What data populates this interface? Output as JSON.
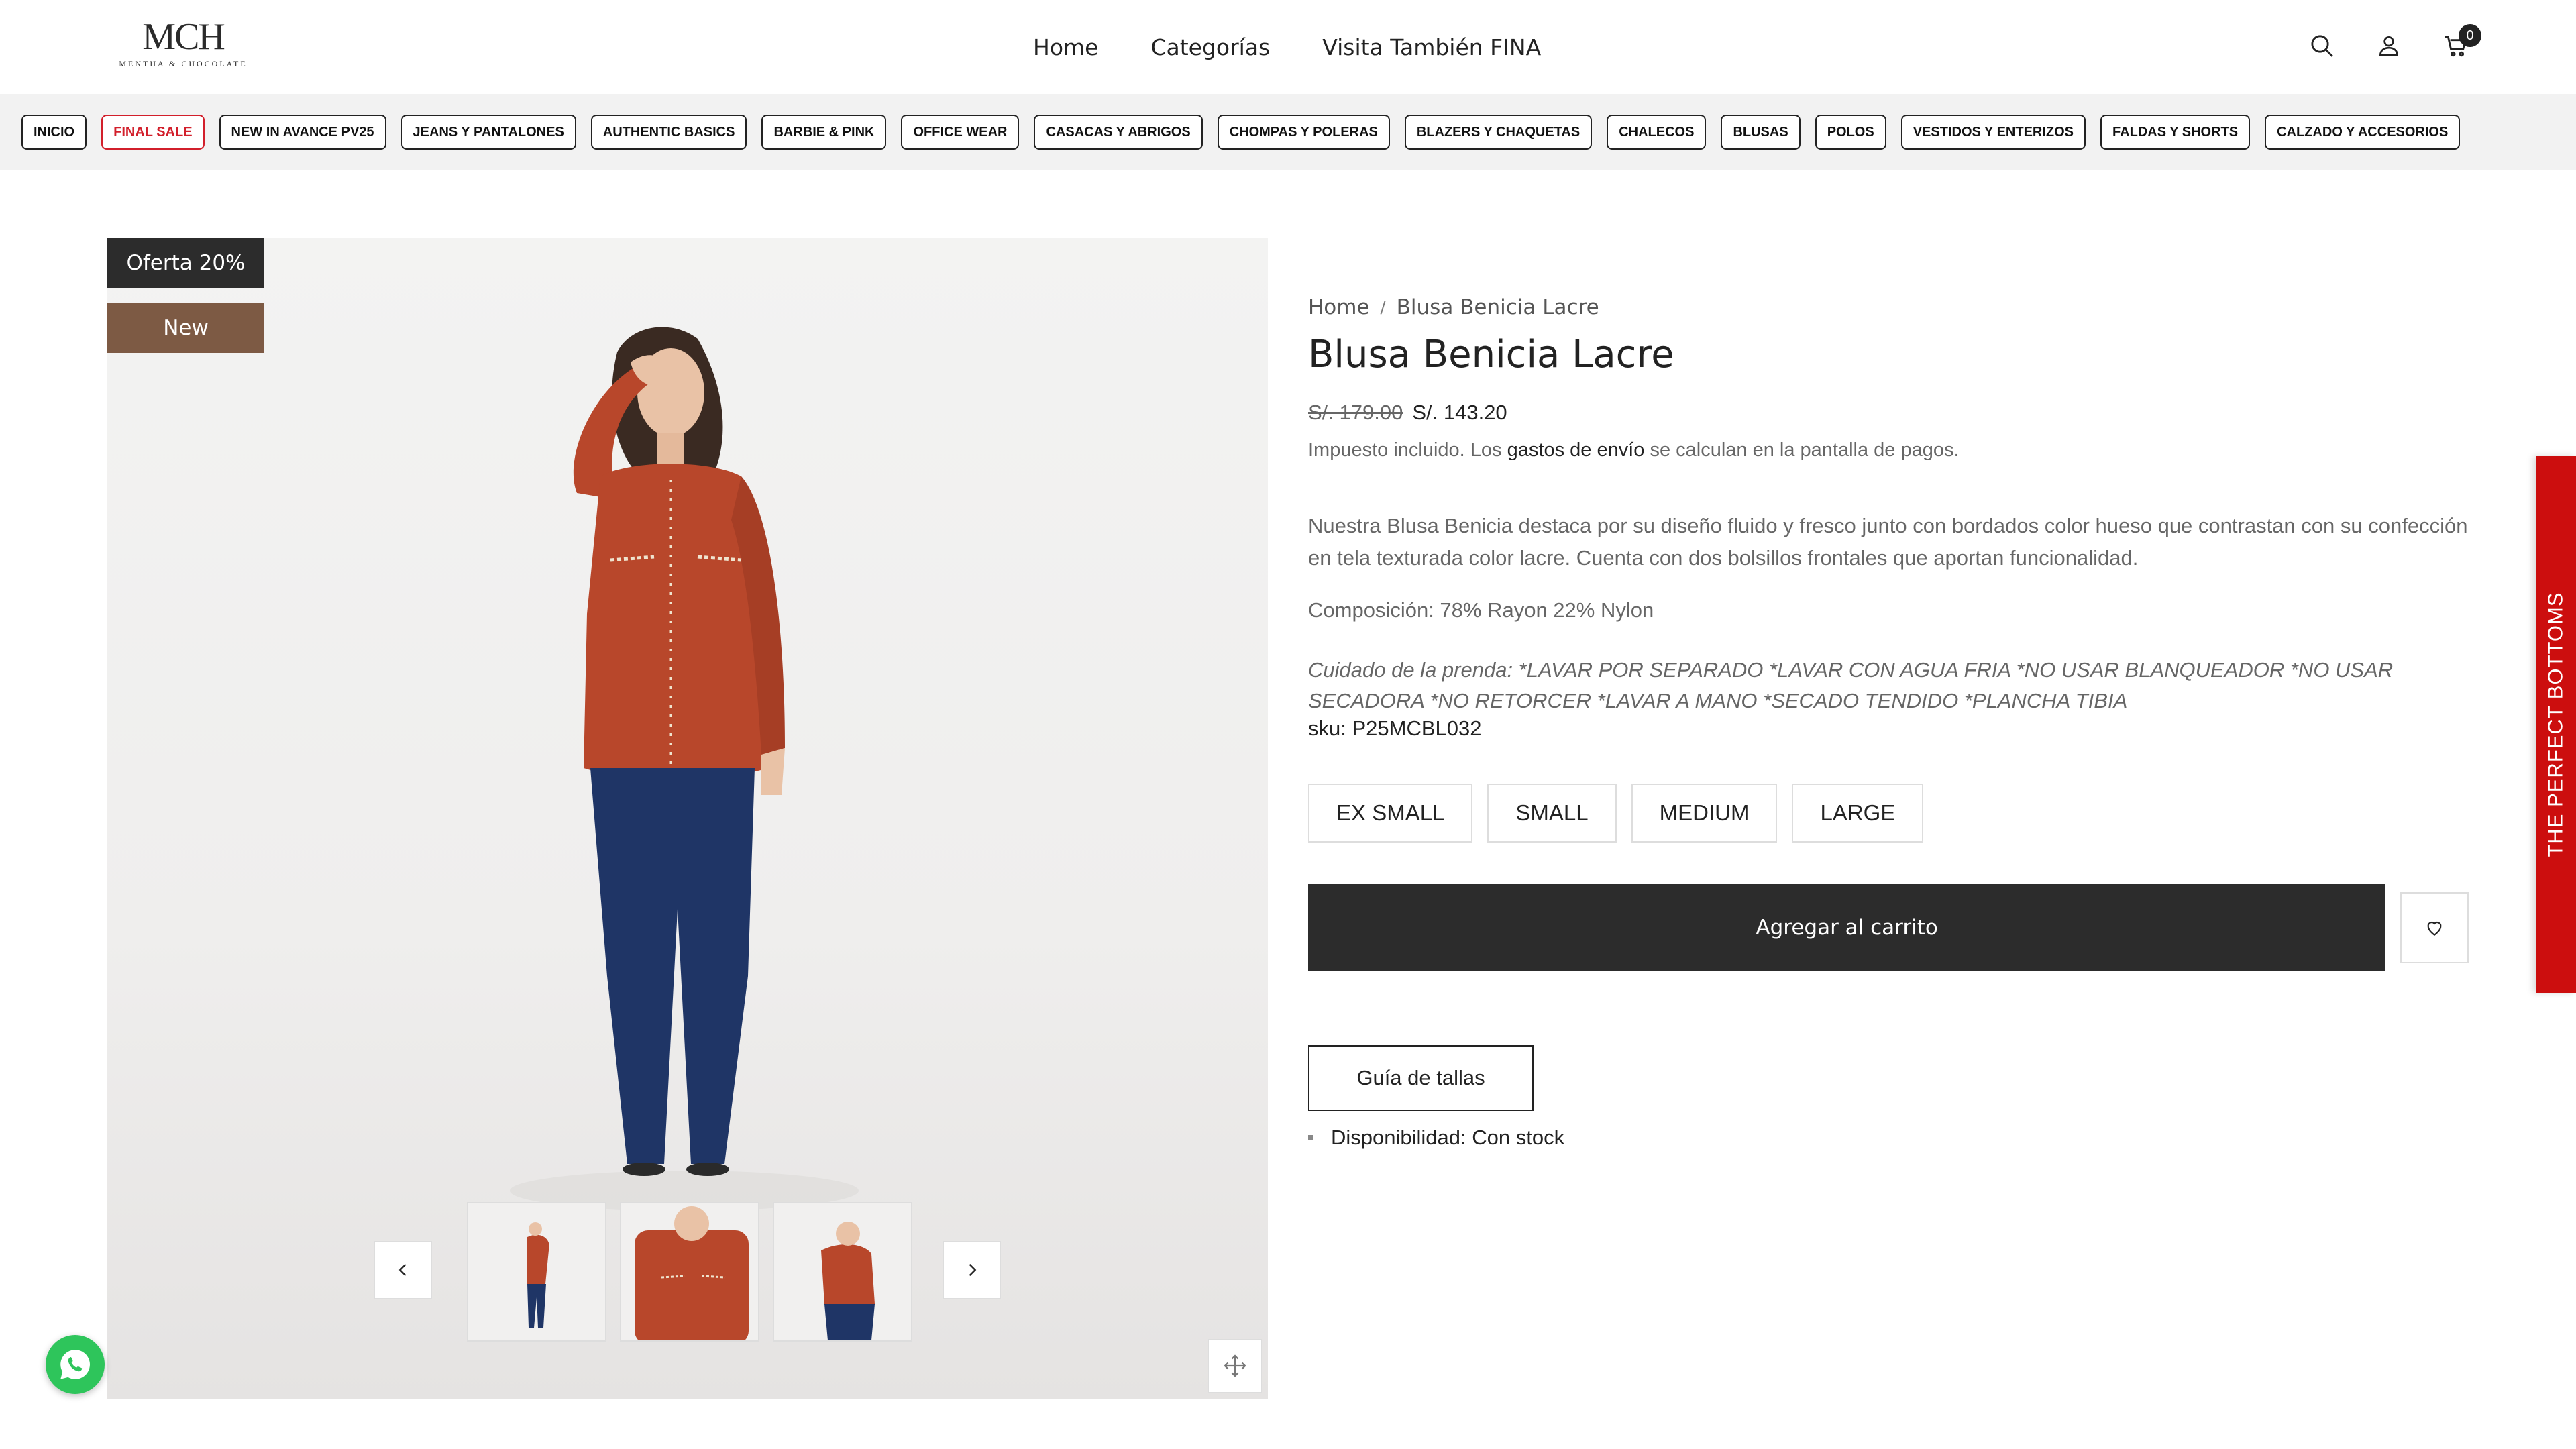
{
  "brand": {
    "logo_mark": "MCH",
    "logo_sub": "MENTHA & CHOCOLATE"
  },
  "nav": {
    "home": "Home",
    "categories": "Categorías",
    "visit": "Visita También FINA"
  },
  "cart": {
    "count": "0"
  },
  "categories": [
    "INICIO",
    "FINAL SALE",
    "NEW IN AVANCE PV25",
    "JEANS Y PANTALONES",
    "AUTHENTIC BASICS",
    "BARBIE & PINK",
    "OFFICE WEAR",
    "CASACAS Y ABRIGOS",
    "CHOMPAS Y POLERAS",
    "BLAZERS Y CHAQUETAS",
    "CHALECOS",
    "BLUSAS",
    "POLOS",
    "VESTIDOS Y ENTERIZOS",
    "FALDAS Y SHORTS",
    "CALZADO Y ACCESORIOS"
  ],
  "badges": {
    "sale": "Oferta 20%",
    "new": "New"
  },
  "product": {
    "breadcrumb_home": "Home",
    "breadcrumb_current": "Blusa Benicia Lacre",
    "title": "Blusa Benicia Lacre",
    "price_old": "S/. 179.00",
    "price_new": "S/. 143.20",
    "tax_pre": "Impuesto incluido. Los ",
    "tax_link": "gastos de envío",
    "tax_post": " se calculan en la pantalla de pagos.",
    "description": "Nuestra Blusa Benicia destaca por su diseño fluido y fresco junto con bordados color hueso que contrastan con su confección en tela texturada color lacre. Cuenta con dos bolsillos frontales que aportan funcionalidad.",
    "composition": "Composición: 78% Rayon 22% Nylon",
    "care": "Cuidado de la prenda: *LAVAR POR SEPARADO *LAVAR CON AGUA FRIA *NO USAR BLANQUEADOR *NO USAR SECADORA *NO RETORCER *LAVAR A MANO *SECADO TENDIDO *PLANCHA TIBIA",
    "sku": "sku: P25MCBL032",
    "sizes": [
      "EX SMALL",
      "SMALL",
      "MEDIUM",
      "LARGE"
    ],
    "add_to_cart": "Agregar al carrito",
    "size_guide": "Guía de tallas",
    "availability": "Disponibilidad: Con stock"
  },
  "side_tab": "THE PERFECT BOTTOMS",
  "colors": {
    "accent_dark": "#2c2c2c",
    "new_badge": "#7d5a44",
    "sale_red": "#d21f2b",
    "side_tab": "#cc0e0e",
    "whatsapp": "#2ec55b",
    "blouse": "#b8472b",
    "jeans": "#1f3566"
  },
  "icons": [
    "search-icon",
    "user-icon",
    "cart-icon",
    "chevron-left-icon",
    "chevron-right-icon",
    "expand-icon",
    "heart-icon",
    "whatsapp-icon"
  ]
}
